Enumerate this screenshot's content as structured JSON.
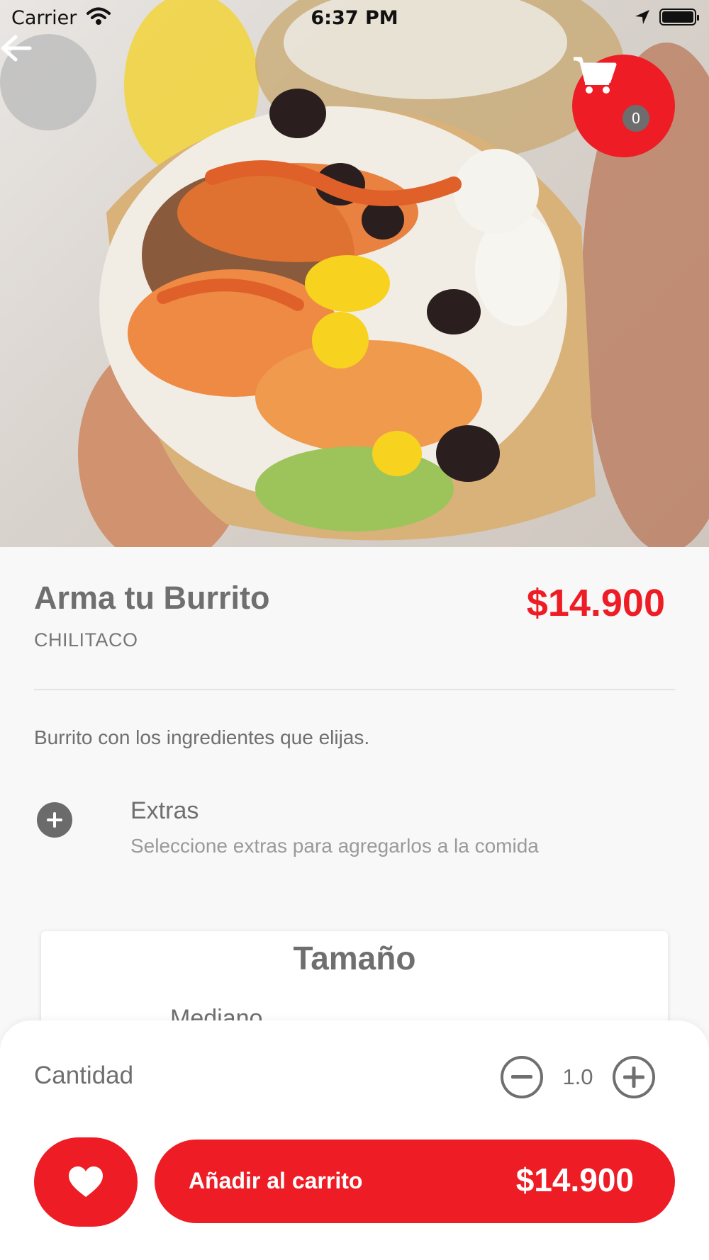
{
  "status_bar": {
    "carrier": "Carrier",
    "time": "6:37 PM"
  },
  "header": {
    "back_icon": "arrow-left-icon",
    "cart_icon": "shopping-cart-icon",
    "cart_count": "0"
  },
  "product": {
    "title": "Arma tu Burrito",
    "price": "$14.900",
    "restaurant": "CHILITACO",
    "description": "Burrito con los ingredientes que elijas."
  },
  "extras": {
    "icon": "plus-circle-icon",
    "title": "Extras",
    "subtitle": "Seleccione extras para agregarlos a la comida"
  },
  "size": {
    "title": "Tamaño",
    "visible_option": "Mediano"
  },
  "quantity": {
    "label": "Cantidad",
    "value": "1.0"
  },
  "actions": {
    "favorite_icon": "heart-icon",
    "add_to_cart_label": "Añadir al carrito",
    "add_to_cart_price": "$14.900"
  },
  "colors": {
    "accent": "#ee1c25",
    "text": "#6f6f6f",
    "background": "#f8f8f8"
  }
}
